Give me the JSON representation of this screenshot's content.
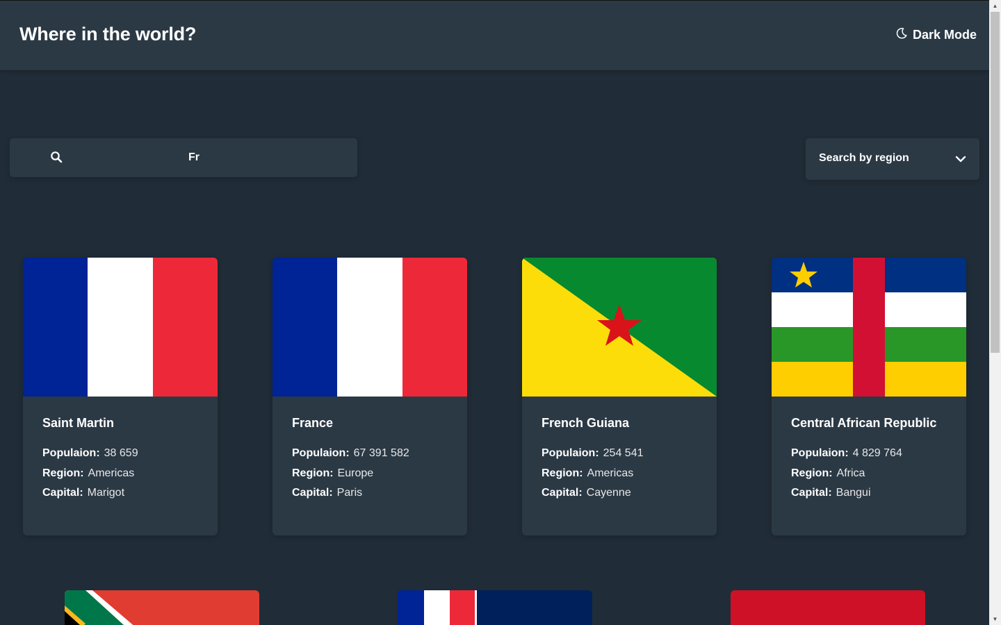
{
  "header": {
    "title": "Where in the world?",
    "theme_toggle_label": "Dark Mode",
    "theme_icon": "moon-icon"
  },
  "search": {
    "value": "Fr",
    "icon": "search-icon"
  },
  "region_filter": {
    "label": "Search by region",
    "icon": "chevron-down-icon"
  },
  "labels": {
    "population": "Populaion:",
    "region": "Region:",
    "capital": "Capital:"
  },
  "countries": [
    {
      "name": "Saint Martin",
      "population": "38 659",
      "region": "Americas",
      "capital": "Marigot"
    },
    {
      "name": "France",
      "population": "67 391 582",
      "region": "Europe",
      "capital": "Paris"
    },
    {
      "name": "French Guiana",
      "population": "254 541",
      "region": "Americas",
      "capital": "Cayenne"
    },
    {
      "name": "Central African Republic",
      "population": "4 829 764",
      "region": "Africa",
      "capital": "Bangui"
    }
  ],
  "colors": {
    "background": "#202c37",
    "element": "#2b3945",
    "text": "#ffffff"
  }
}
